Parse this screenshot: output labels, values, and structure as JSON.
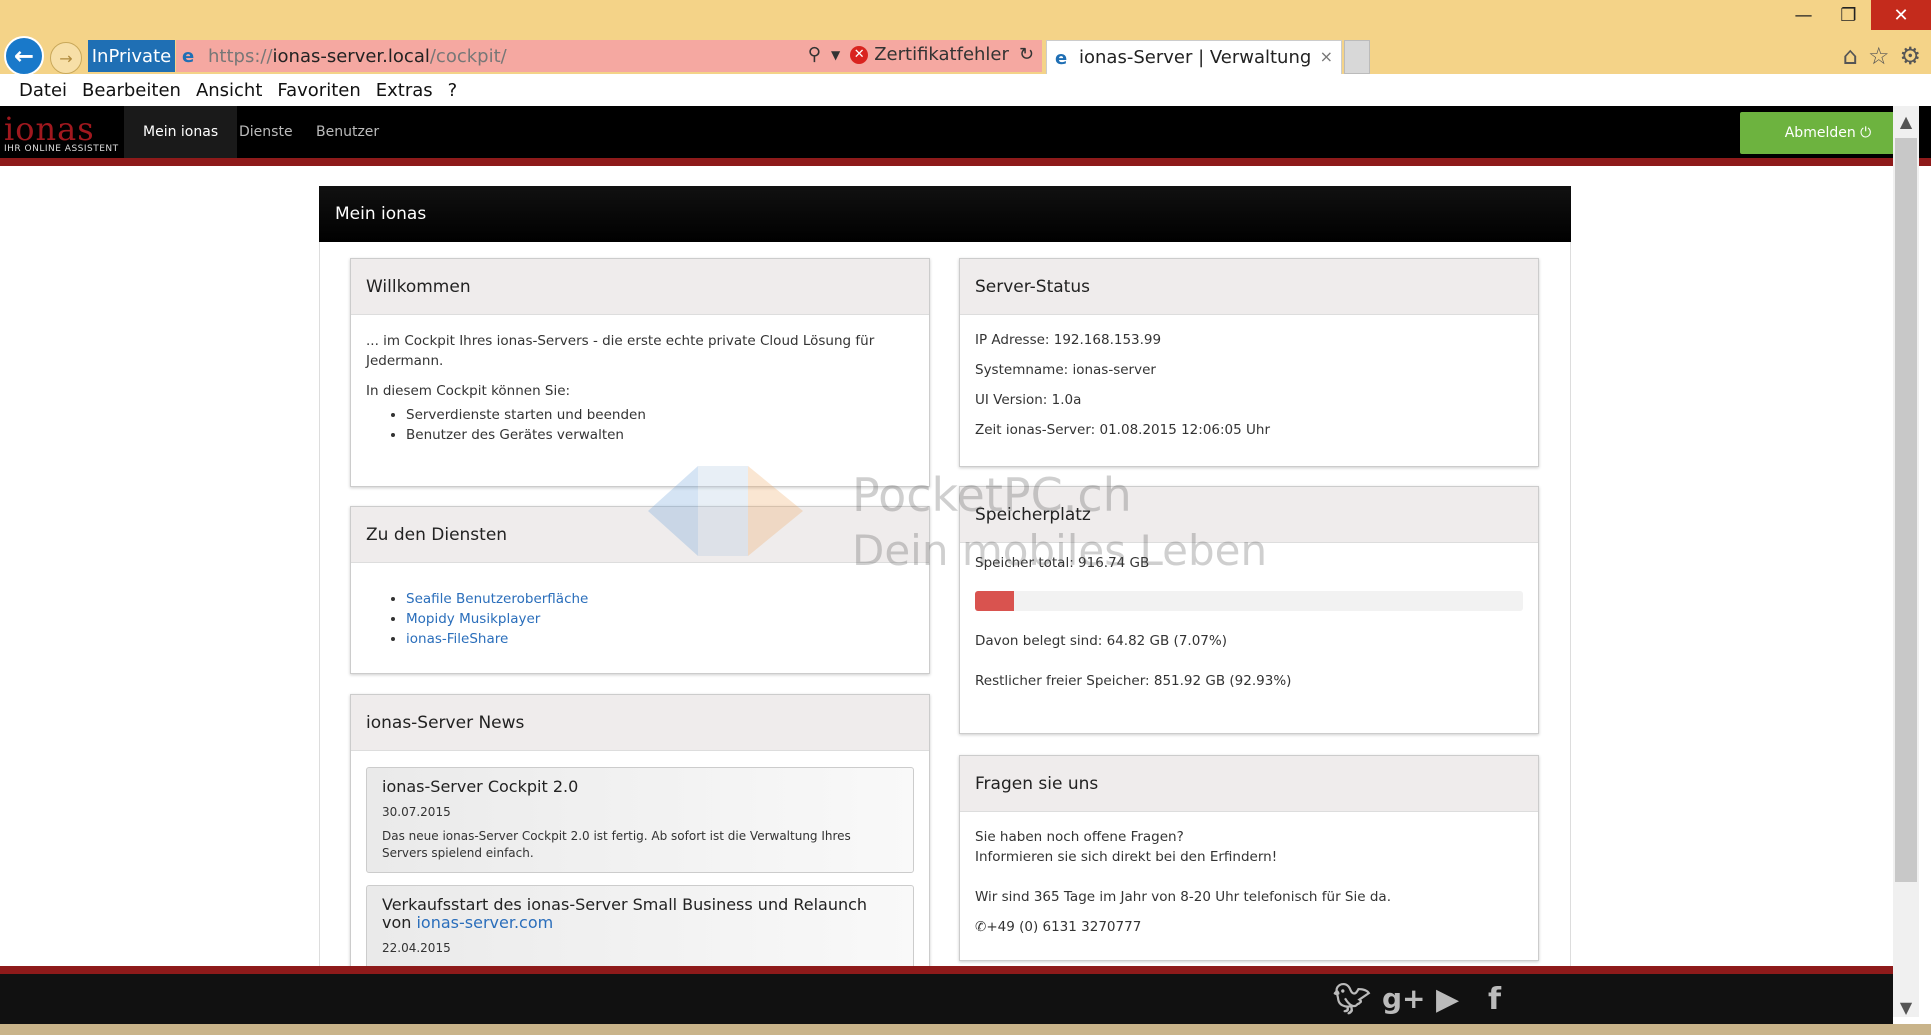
{
  "browser": {
    "inprivate_label": "InPrivate",
    "url_prefix": "https://",
    "url_host": "ionas-server.local",
    "url_path": "/cockpit/",
    "cert_error": "Zertifikatfehler",
    "tab_title": "ionas-Server | Verwaltung",
    "tab_close": "×",
    "menu": [
      "Datei",
      "Bearbeiten",
      "Ansicht",
      "Favoriten",
      "Extras",
      "?"
    ]
  },
  "app": {
    "logo_text": "ionas",
    "logo_subtext": "IHR ONLINE ASSISTENT",
    "nav": [
      "Mein ionas",
      "Dienste",
      "Benutzer"
    ],
    "logout_label": "Abmelden ⏻"
  },
  "page": {
    "title": "Mein ionas"
  },
  "welcome": {
    "title": "Willkommen",
    "intro": "... im Cockpit Ihres ionas-Servers - die erste echte private Cloud Lösung für Jedermann.",
    "lead": "In diesem Cockpit können Sie:",
    "items": [
      "Serverdienste starten und beenden",
      "Benutzer des Gerätes verwalten"
    ]
  },
  "services": {
    "title": "Zu den Diensten",
    "links": [
      "Seafile Benutzeroberfläche",
      "Mopidy Musikplayer",
      "ionas-FileShare"
    ]
  },
  "news": {
    "title": "ionas-Server News",
    "items": [
      {
        "title": "ionas-Server Cockpit 2.0",
        "date": "30.07.2015",
        "text": "Das neue ionas-Server Cockpit 2.0 ist fertig. Ab sofort ist die Verwaltung Ihres Servers spielend einfach."
      },
      {
        "title_prefix": "Verkaufsstart des ionas-Server Small Business und Relaunch von ",
        "title_link": "ionas-server.com",
        "date": "22.04.2015"
      }
    ]
  },
  "server_status": {
    "title": "Server-Status",
    "lines": [
      "IP Adresse: 192.168.153.99",
      "Systemname: ionas-server",
      "UI Version: 1.0a",
      "Zeit ionas-Server: 01.08.2015 12:06:05 Uhr"
    ]
  },
  "storage": {
    "title": "Speicherplatz",
    "total": "Speicher total: 916.74 GB",
    "used_fraction": 0.0707,
    "used": "Davon belegt sind: 64.82 GB (7.07%)",
    "free": "Restlicher freier Speicher: 851.92 GB (92.93%)",
    "bar_color": "#d9534f"
  },
  "contact": {
    "title": "Fragen sie uns",
    "line1": "Sie haben noch offene Fragen?",
    "line2": "Informieren sie sich direkt bei den Erfindern!",
    "line3": "Wir sind 365 Tage im Jahr von 8-20 Uhr telefonisch für Sie da.",
    "phone": "+49 (0) 6131 3270777"
  },
  "watermark": {
    "line1": "PocketPC.ch",
    "line2": "Dein mobiles Leben"
  },
  "social": [
    "twitter-icon",
    "google-plus-icon",
    "youtube-icon",
    "facebook-icon"
  ]
}
